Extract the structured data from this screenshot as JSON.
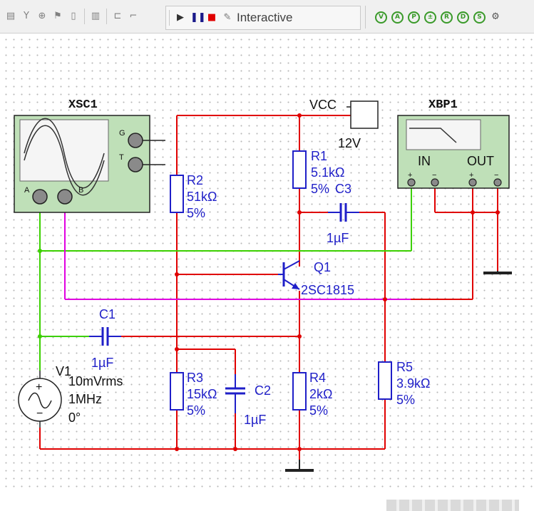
{
  "toolbar": {
    "mode_label": "Interactive",
    "left_icons": [
      "component-icon",
      "antenna-icon",
      "ground-icon",
      "bus-icon",
      "tape-icon",
      "meter-icon",
      "port-icon",
      "connector-icon"
    ],
    "right_icons": [
      "probe-voltage-icon",
      "probe-current-icon",
      "probe-power-icon",
      "probe-diff-icon",
      "probe-ref-icon",
      "probe-digital-icon",
      "probe-settings-icon",
      "gear-icon"
    ]
  },
  "colors": {
    "wire_red": "#e00000",
    "wire_green": "#3cd000",
    "wire_magenta": "#e000e0",
    "component_blue": "#1f1fc8",
    "instrument_bg": "#bfe0b8"
  },
  "instruments": {
    "oscilloscope": {
      "name": "XSC1",
      "ports": [
        "A",
        "B",
        "G",
        "T"
      ]
    },
    "bode_plotter": {
      "name": "XBP1",
      "in_label": "IN",
      "out_label": "OUT",
      "plus": "+",
      "minus": "−"
    }
  },
  "supply": {
    "name": "VCC",
    "voltage": "12V"
  },
  "components": {
    "R1": {
      "name": "R1",
      "value": "5.1kΩ",
      "tol": "5%"
    },
    "R2": {
      "name": "R2",
      "value": "51kΩ",
      "tol": "5%"
    },
    "R3": {
      "name": "R3",
      "value": "15kΩ",
      "tol": "5%"
    },
    "R4": {
      "name": "R4",
      "value": "2kΩ",
      "tol": "5%"
    },
    "R5": {
      "name": "R5",
      "value": "3.9kΩ",
      "tol": "5%"
    },
    "C1": {
      "name": "C1",
      "value": "1µF"
    },
    "C2": {
      "name": "C2",
      "value": "1µF"
    },
    "C3": {
      "name": "C3",
      "value": "1µF"
    },
    "Q1": {
      "name": "Q1",
      "model": "2SC1815"
    },
    "V1": {
      "name": "V1",
      "amplitude": "10mVrms",
      "frequency": "1MHz",
      "phase": "0°",
      "plus": "+",
      "minus": "−"
    }
  }
}
